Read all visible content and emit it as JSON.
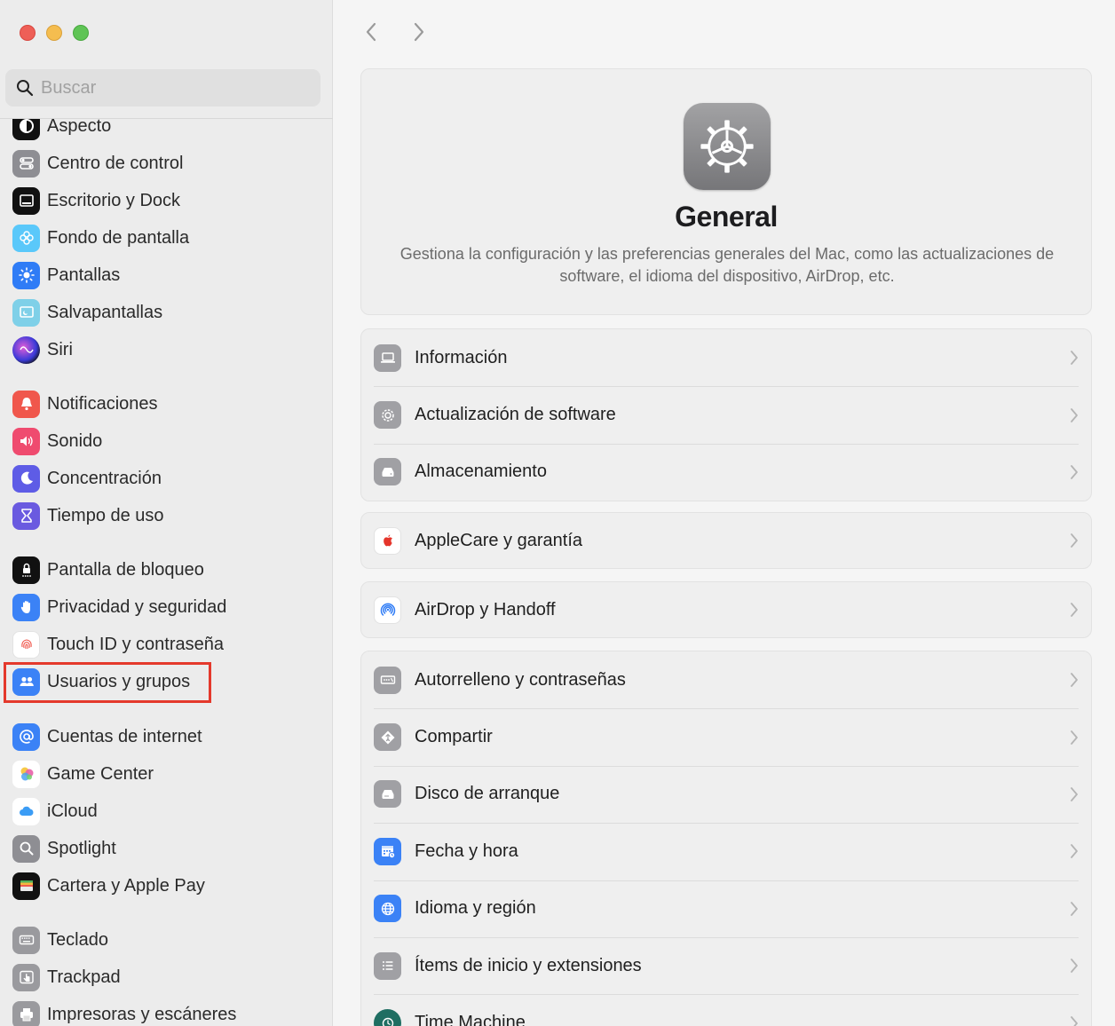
{
  "window": {
    "traffic_lights": [
      "close",
      "minimize",
      "zoom"
    ]
  },
  "search": {
    "placeholder": "Buscar"
  },
  "sidebar": {
    "items": [
      {
        "label": "Aspecto",
        "icon": "appearance-icon"
      },
      {
        "label": "Centro de control",
        "icon": "control-center-icon"
      },
      {
        "label": "Escritorio y Dock",
        "icon": "desktop-dock-icon"
      },
      {
        "label": "Fondo de pantalla",
        "icon": "wallpaper-icon"
      },
      {
        "label": "Pantallas",
        "icon": "displays-icon"
      },
      {
        "label": "Salvapantallas",
        "icon": "screensaver-icon"
      },
      {
        "label": "Siri",
        "icon": "siri-icon"
      },
      {
        "label": "Notificaciones",
        "icon": "notifications-icon"
      },
      {
        "label": "Sonido",
        "icon": "sound-icon"
      },
      {
        "label": "Concentración",
        "icon": "focus-icon"
      },
      {
        "label": "Tiempo de uso",
        "icon": "screen-time-icon"
      },
      {
        "label": "Pantalla de bloqueo",
        "icon": "lock-screen-icon"
      },
      {
        "label": "Privacidad y seguridad",
        "icon": "privacy-hand-icon"
      },
      {
        "label": "Touch ID y contraseña",
        "icon": "fingerprint-icon"
      },
      {
        "label": "Usuarios y grupos",
        "icon": "users-groups-icon",
        "highlighted": true
      },
      {
        "label": "Cuentas de internet",
        "icon": "internet-accounts-icon"
      },
      {
        "label": "Game Center",
        "icon": "game-center-icon"
      },
      {
        "label": "iCloud",
        "icon": "icloud-icon"
      },
      {
        "label": "Spotlight",
        "icon": "spotlight-icon"
      },
      {
        "label": "Cartera y Apple Pay",
        "icon": "wallet-icon"
      },
      {
        "label": "Teclado",
        "icon": "keyboard-icon"
      },
      {
        "label": "Trackpad",
        "icon": "trackpad-icon"
      },
      {
        "label": "Impresoras y escáneres",
        "icon": "printer-icon"
      }
    ]
  },
  "main": {
    "hero": {
      "title": "General",
      "description": "Gestiona la configuración y las preferencias generales del Mac, como las actualizaciones de software, el idioma del dispositivo, AirDrop, etc.",
      "icon": "general-gear-icon"
    },
    "groups": [
      {
        "rows": [
          {
            "label": "Información",
            "icon": "laptop-icon"
          },
          {
            "label": "Actualización de software",
            "icon": "software-update-icon"
          },
          {
            "label": "Almacenamiento",
            "icon": "storage-icon"
          }
        ]
      },
      {
        "rows": [
          {
            "label": "AppleCare y garantía",
            "icon": "apple-logo-icon"
          }
        ]
      },
      {
        "rows": [
          {
            "label": "AirDrop y Handoff",
            "icon": "airdrop-icon"
          }
        ]
      },
      {
        "rows": [
          {
            "label": "Autorrelleno y contraseñas",
            "icon": "autofill-icon"
          },
          {
            "label": "Compartir",
            "icon": "sharing-icon"
          },
          {
            "label": "Disco de arranque",
            "icon": "startup-disk-icon"
          },
          {
            "label": "Fecha y hora",
            "icon": "date-time-icon"
          },
          {
            "label": "Idioma y región",
            "icon": "globe-icon"
          },
          {
            "label": "Ítems de inicio y extensiones",
            "icon": "login-items-icon"
          },
          {
            "label": "Time Machine",
            "icon": "time-machine-icon"
          }
        ]
      }
    ]
  },
  "colors": {
    "highlight_border": "#e4392c",
    "accent_blue": "#3b82f6"
  }
}
